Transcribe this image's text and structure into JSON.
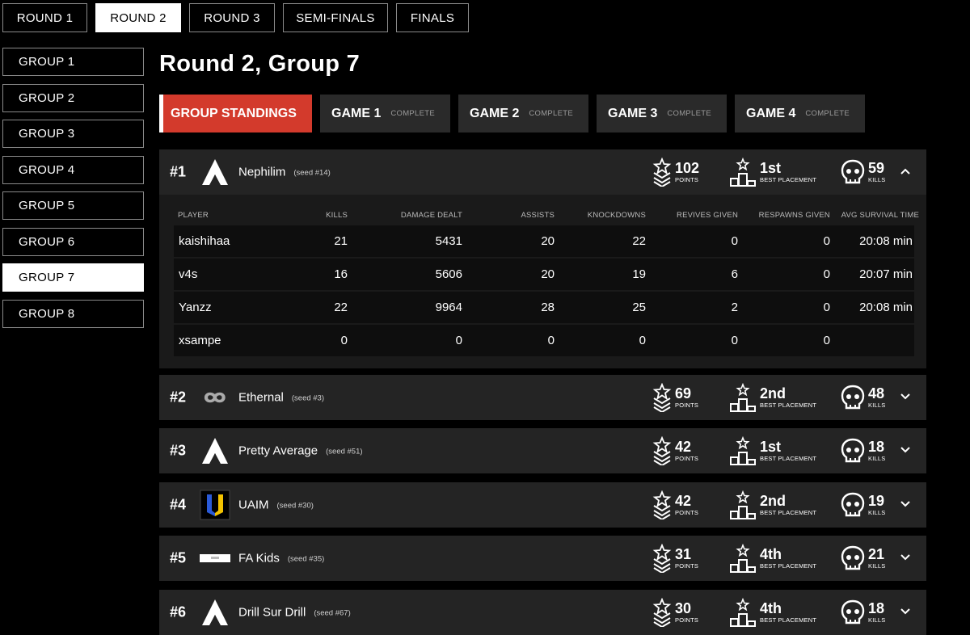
{
  "round_tabs": [
    {
      "label": "ROUND 1",
      "active": false
    },
    {
      "label": "ROUND 2",
      "active": true
    },
    {
      "label": "ROUND 3",
      "active": false
    },
    {
      "label": "SEMI-FINALS",
      "active": false
    },
    {
      "label": "FINALS",
      "active": false
    }
  ],
  "groups": [
    "GROUP 1",
    "GROUP 2",
    "GROUP 3",
    "GROUP 4",
    "GROUP 5",
    "GROUP 6",
    "GROUP 7",
    "GROUP 8"
  ],
  "active_group": "GROUP 7",
  "page_title": "Round 2, Group 7",
  "game_tabs": [
    {
      "label": "GROUP STANDINGS",
      "status": "",
      "active": true
    },
    {
      "label": "GAME 1",
      "status": "COMPLETE",
      "active": false
    },
    {
      "label": "GAME 2",
      "status": "COMPLETE",
      "active": false
    },
    {
      "label": "GAME 3",
      "status": "COMPLETE",
      "active": false
    },
    {
      "label": "GAME 4",
      "status": "COMPLETE",
      "active": false
    }
  ],
  "stat_labels": {
    "points": "POINTS",
    "placement": "BEST PLACEMENT",
    "kills": "KILLS"
  },
  "player_headers": [
    "PLAYER",
    "KILLS",
    "DAMAGE DEALT",
    "ASSISTS",
    "KNOCKDOWNS",
    "REVIVES GIVEN",
    "RESPAWNS GIVEN",
    "AVG SURVIVAL TIME"
  ],
  "teams": [
    {
      "rank": "#1",
      "name": "Nephilim",
      "seed": "(seed #14)",
      "logo": "apex-logo-icon",
      "points": "102",
      "placement": "1st",
      "kills": "59",
      "expanded": true,
      "players": [
        [
          "kaishihaa",
          "21",
          "5431",
          "20",
          "22",
          "0",
          "0",
          "20:08 min"
        ],
        [
          "v4s",
          "16",
          "5606",
          "20",
          "19",
          "6",
          "0",
          "20:07 min"
        ],
        [
          "Yanzz",
          "22",
          "9964",
          "28",
          "25",
          "2",
          "0",
          "20:08 min"
        ],
        [
          "xsampe",
          "0",
          "0",
          "0",
          "0",
          "0",
          "0",
          ""
        ]
      ]
    },
    {
      "rank": "#2",
      "name": "Ethernal",
      "seed": "(seed #3)",
      "logo": "infinity-logo-icon",
      "points": "69",
      "placement": "2nd",
      "kills": "48",
      "expanded": false
    },
    {
      "rank": "#3",
      "name": "Pretty Average",
      "seed": "(seed #51)",
      "logo": "apex-logo-icon",
      "points": "42",
      "placement": "1st",
      "kills": "18",
      "expanded": false
    },
    {
      "rank": "#4",
      "name": "UAIM",
      "seed": "(seed #30)",
      "logo": "uaim-logo-icon",
      "points": "42",
      "placement": "2nd",
      "kills": "19",
      "expanded": false
    },
    {
      "rank": "#5",
      "name": "FA Kids",
      "seed": "(seed #35)",
      "logo": "fakids-logo-icon",
      "points": "31",
      "placement": "4th",
      "kills": "21",
      "expanded": false
    },
    {
      "rank": "#6",
      "name": "Drill Sur Drill",
      "seed": "(seed #67)",
      "logo": "apex-logo-icon",
      "points": "30",
      "placement": "4th",
      "kills": "18",
      "expanded": false
    }
  ],
  "colors": {
    "accent": "#d33a2c",
    "panel": "#242424",
    "player_panel": "#1a1a1a",
    "uaim_blue": "#2a5ad8",
    "uaim_yellow": "#f2c200"
  }
}
